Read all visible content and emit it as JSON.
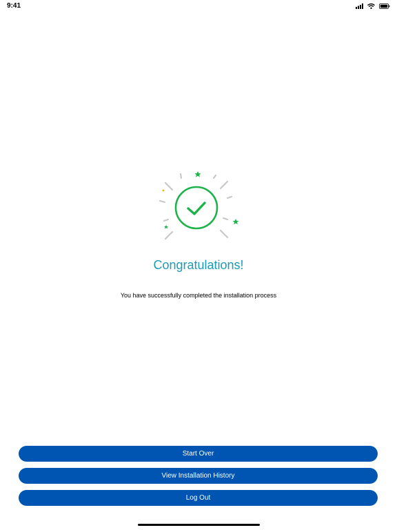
{
  "status_bar": {
    "time": "9:41",
    "icons": [
      "cellular-signal-icon",
      "wifi-icon",
      "battery-icon"
    ]
  },
  "success": {
    "icon": "checkmark-circle-icon",
    "title": "Congratulations!",
    "message": "You have successfully completed the installation process"
  },
  "actions": {
    "start_over": "Start Over",
    "view_history": "View Installation History",
    "log_out": "Log Out"
  },
  "colors": {
    "accent_teal": "#1a9bb8",
    "success_green": "#1db34a",
    "button_blue": "#0055b3",
    "sparkle_yellow": "#e8b400",
    "ray_gray": "#c8c8c8"
  }
}
